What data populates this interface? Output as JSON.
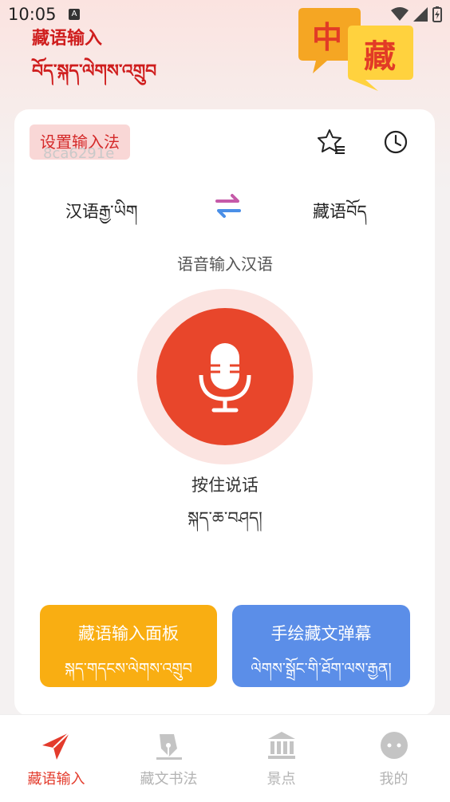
{
  "status_bar": {
    "time": "10:05",
    "notification_icon": "A"
  },
  "header": {
    "title_zh": "藏语输入",
    "title_bo": "བོད་སྐད་ལེགས་འགྲུབ",
    "logo_char_1": "中",
    "logo_char_2": "藏"
  },
  "toolbar": {
    "set_input_method": "设置输入法",
    "watermark": "8ca6291e",
    "favorites_icon": "star-list-icon",
    "history_icon": "clock-icon"
  },
  "language": {
    "source": "汉语རྒྱ་ཡིག",
    "target": "藏语བོད",
    "swap_icon": "swap-icon"
  },
  "voice": {
    "mode_label": "语音输入汉语",
    "hold_zh": "按住说话",
    "hold_bo": "སྐད་ཆ་བཤད།"
  },
  "actions": {
    "panel_zh": "藏语输入面板",
    "panel_bo": "སྐད་གདངས་ལེགས་འགྲུབ",
    "handwrite_zh": "手绘藏文弹幕",
    "handwrite_bo": "ལེགས་སྒྲོང་གི་ཐོག་ལས་རྒྱན།"
  },
  "tabs": [
    {
      "label": "藏语输入",
      "icon": "paper-plane-icon",
      "active": true
    },
    {
      "label": "藏文书法",
      "icon": "pen-icon",
      "active": false
    },
    {
      "label": "景点",
      "icon": "building-icon",
      "active": false
    },
    {
      "label": "我的",
      "icon": "chat-bubble-icon",
      "active": false
    }
  ],
  "colors": {
    "accent_red": "#e8462b",
    "title_red": "#cf1d1d",
    "orange": "#f9ae12",
    "blue": "#5b8ee8"
  }
}
